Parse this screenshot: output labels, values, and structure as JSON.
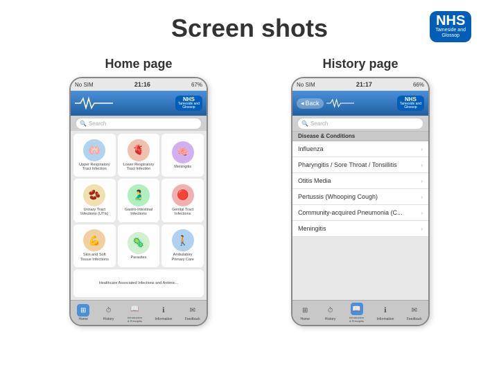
{
  "page": {
    "title": "Screen shots"
  },
  "nhs_logo": {
    "text": "NHS",
    "subtitle": "Tameside and\nGlossop"
  },
  "home_section": {
    "label": "Home page",
    "status_bar": {
      "left": "No SIM",
      "center": "21:16",
      "right": "67%"
    },
    "header": {
      "nhs_text": "NHS",
      "nhs_sub": "Tameside and Glossop"
    },
    "search_placeholder": "Search",
    "icons": [
      {
        "label": "Upper Respiratory\nTract Infection",
        "emoji": "🫁",
        "color": "#b0d4f0"
      },
      {
        "label": "Lower Respiratory\nTract Infection",
        "emoji": "🫀",
        "color": "#f0c0b0"
      },
      {
        "label": "Meningitis",
        "emoji": "🧠",
        "color": "#d0b0f0"
      },
      {
        "label": "Urinary Tract\nInfections (UTIs)",
        "emoji": "🫘",
        "color": "#f0e0b0"
      },
      {
        "label": "Gastro-Intestinal\nInfections",
        "emoji": "🫃",
        "color": "#b0f0c0"
      },
      {
        "label": "Genital Tract\nInfections",
        "emoji": "🔴",
        "color": "#f0b0b0"
      },
      {
        "label": "Skin and Soft\nTissue Infections",
        "emoji": "💪",
        "color": "#f0d0a0"
      },
      {
        "label": "Parasites",
        "emoji": "🦠",
        "color": "#d0f0d0"
      },
      {
        "label": "Ambulatory\nPrimary Care",
        "emoji": "🚶",
        "color": "#b0d0f0"
      }
    ],
    "healthcare_label": "Healthcare Associated\nInfections and Antimic...",
    "nav_items": [
      {
        "label": "Home",
        "icon": "⊞",
        "active": true
      },
      {
        "label": "History",
        "icon": "⏱",
        "active": false
      },
      {
        "label": "Introduction\n& Principles",
        "icon": "📖",
        "active": false
      },
      {
        "label": "Information",
        "icon": "ℹ",
        "active": false
      },
      {
        "label": "Feedback",
        "icon": "✉",
        "active": false
      }
    ]
  },
  "history_section": {
    "label": "History page",
    "status_bar": {
      "left": "No SIM",
      "center": "21:17",
      "right": "66%"
    },
    "back_button": "Back",
    "header": {
      "nhs_text": "NHS",
      "nhs_sub": "Tameside and Glossop"
    },
    "search_placeholder": "Search",
    "section_header": "Disease & Conditions",
    "list_items": [
      "Influenza",
      "Pharyngitis / Sore Throat / Tonsillitis",
      "Otitis Media",
      "Pertussis (Whooping Cough)",
      "Community-acquired Pneumonia (C...",
      "Meningitis"
    ],
    "nav_items": [
      {
        "label": "Home",
        "icon": "⊞",
        "active": false
      },
      {
        "label": "History",
        "icon": "⏱",
        "active": false
      },
      {
        "label": "Introduction\n& Principles",
        "icon": "📖",
        "active": false
      },
      {
        "label": "Information",
        "icon": "ℹ",
        "active": false
      },
      {
        "label": "Feedback",
        "icon": "✉",
        "active": false
      }
    ]
  }
}
